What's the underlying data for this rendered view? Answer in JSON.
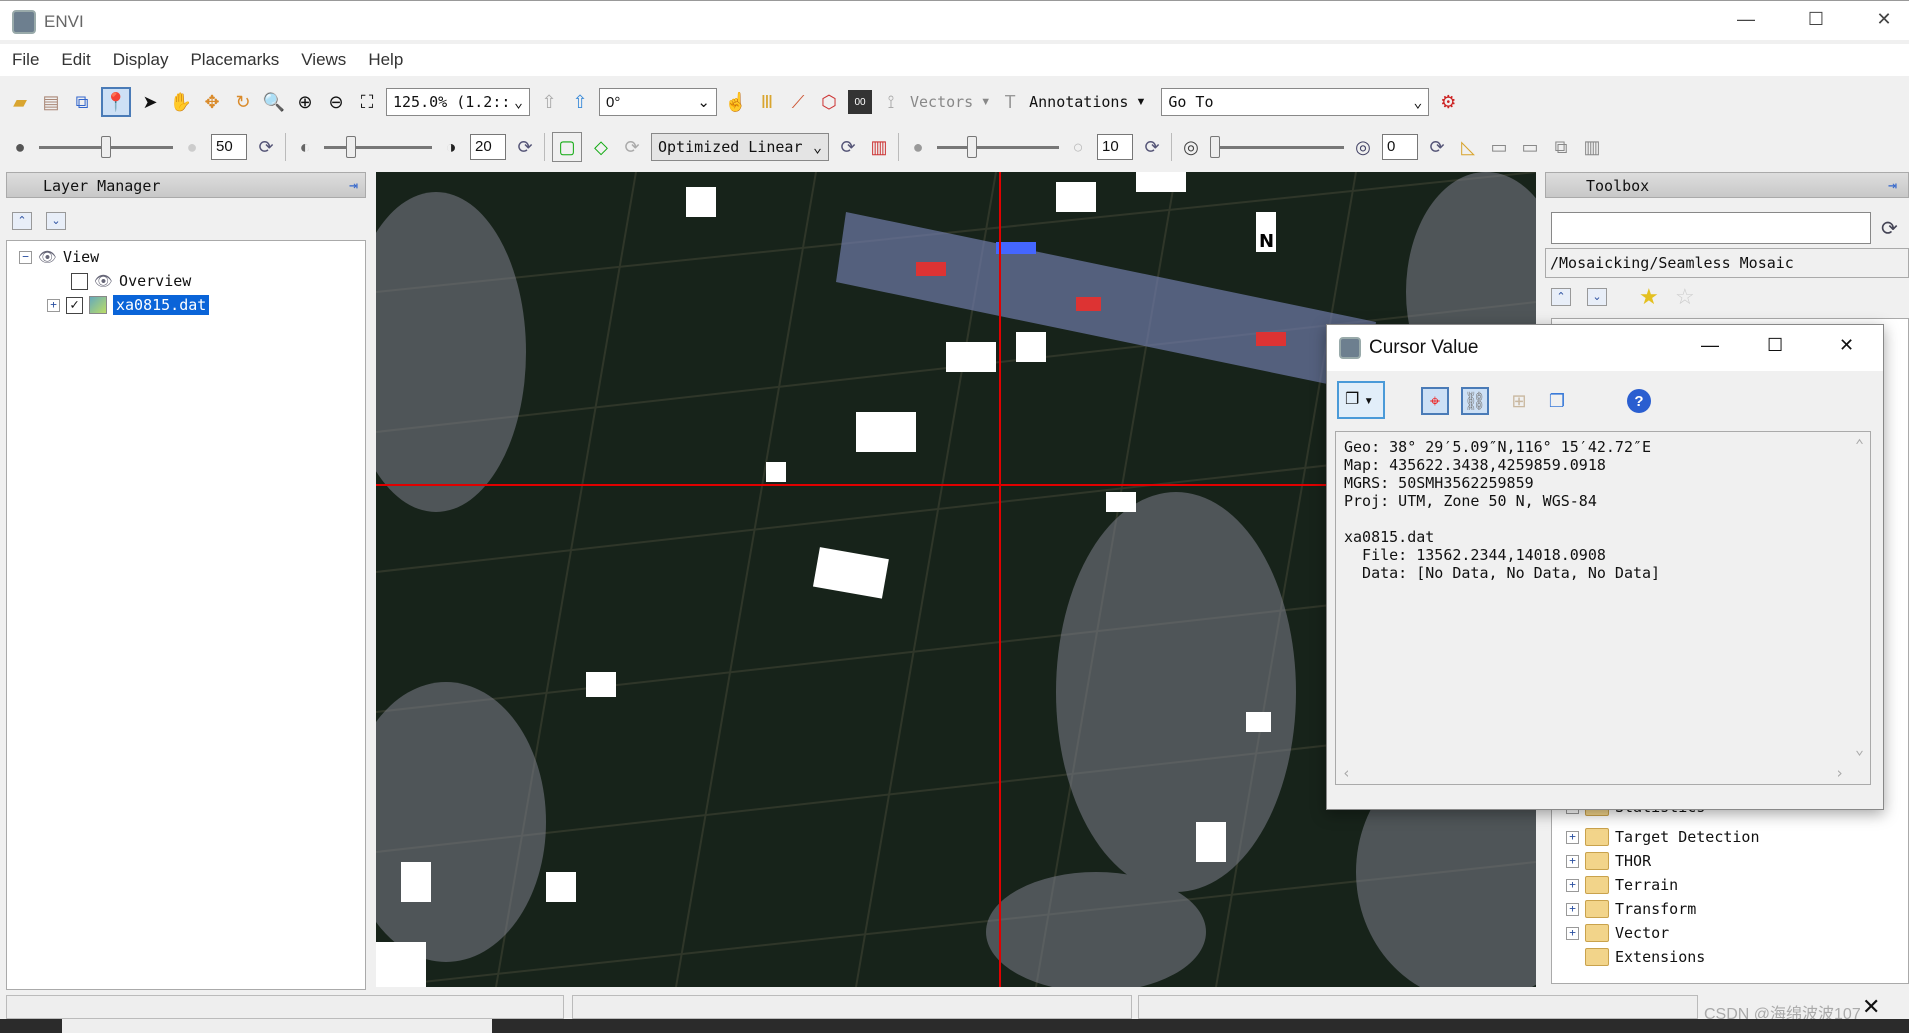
{
  "window": {
    "title": "ENVI"
  },
  "menu": [
    "File",
    "Edit",
    "Display",
    "Placemarks",
    "Views",
    "Help"
  ],
  "toolbar1": {
    "zoom": "125.0% (1.2::",
    "rotation": "0°",
    "vectors": "Vectors",
    "annotations": "Annotations",
    "goto": "Go To"
  },
  "toolbar2": {
    "brightness": "50",
    "contrast": "20",
    "stretch": "Optimized Linear",
    "sharpen": "10",
    "transparency": "0"
  },
  "layer_manager": {
    "title": "Layer Manager",
    "items": [
      {
        "label": "View",
        "expanded": true
      },
      {
        "label": "Overview",
        "checked": false
      },
      {
        "label": "xa0815.dat",
        "checked": true,
        "selected": true
      }
    ]
  },
  "toolbox": {
    "title": "Toolbox",
    "search": "",
    "path": "/Mosaicking/Seamless Mosaic",
    "items": [
      "Statistics",
      "Target Detection",
      "THOR",
      "Terrain",
      "Transform",
      "Vector",
      "Extensions"
    ]
  },
  "cursor_value": {
    "title": "Cursor Value",
    "lines": [
      "Geo: 38° 29′5.09″N,116° 15′42.72″E",
      "Map: 435622.3438,4259859.0918",
      "MGRS: 50SMH3562259859",
      "Proj: UTM, Zone 50 N, WGS-84",
      "",
      "xa0815.dat",
      "  File: 13562.2344,14018.0908",
      "  Data: [No Data, No Data, No Data]"
    ]
  },
  "watermark": "CSDN @海绵波波107",
  "colors": {
    "crosshair": "#e00000",
    "selection": "#0a64d8"
  }
}
